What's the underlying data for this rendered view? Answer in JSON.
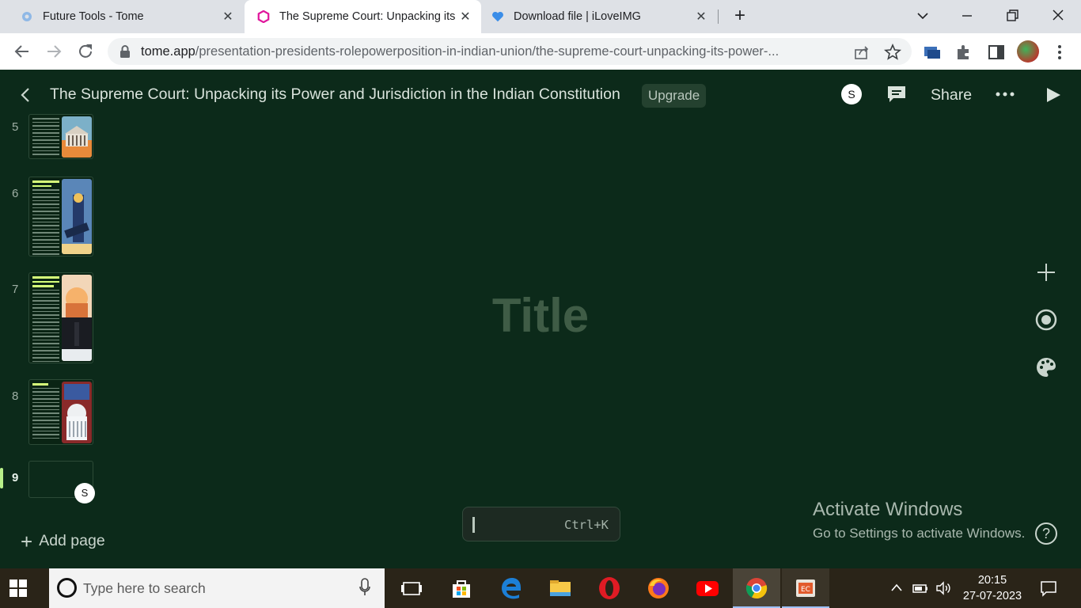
{
  "browser": {
    "tabs": [
      {
        "title": "Future Tools - Tome",
        "favicon": "gear-favicon"
      },
      {
        "title": "The Supreme Court: Unpacking its",
        "favicon": "tome-favicon",
        "active": true
      },
      {
        "title": "Download file | iLoveIMG",
        "favicon": "heart-favicon"
      }
    ],
    "new_tab_label": "+",
    "url_host": "tome.app",
    "url_path": "/presentation-presidents-rolepowerposition-in-indian-union/the-supreme-court-unpacking-its-power-..."
  },
  "app": {
    "doc_title": "The Supreme Court: Unpacking its Power and Jurisdiction in the Indian Constitution",
    "upgrade_label": "Upgrade",
    "user_initial": "S",
    "share_label": "Share",
    "pages": [
      {
        "number": "5"
      },
      {
        "number": "6"
      },
      {
        "number": "7"
      },
      {
        "number": "8"
      },
      {
        "number": "9",
        "active": true
      }
    ],
    "thumb_user_initial": "S",
    "add_page_label": "Add page",
    "canvas_title_placeholder": "Title",
    "command_shortcut": "Ctrl+K"
  },
  "windows_watermark": {
    "line1": "Activate Windows",
    "line2": "Go to Settings to activate Windows."
  },
  "taskbar": {
    "search_placeholder": "Type here to search",
    "time": "20:15",
    "date": "27-07-2023"
  },
  "colors": {
    "app_bg": "#0c2a1a",
    "accent": "#b8f08a"
  }
}
